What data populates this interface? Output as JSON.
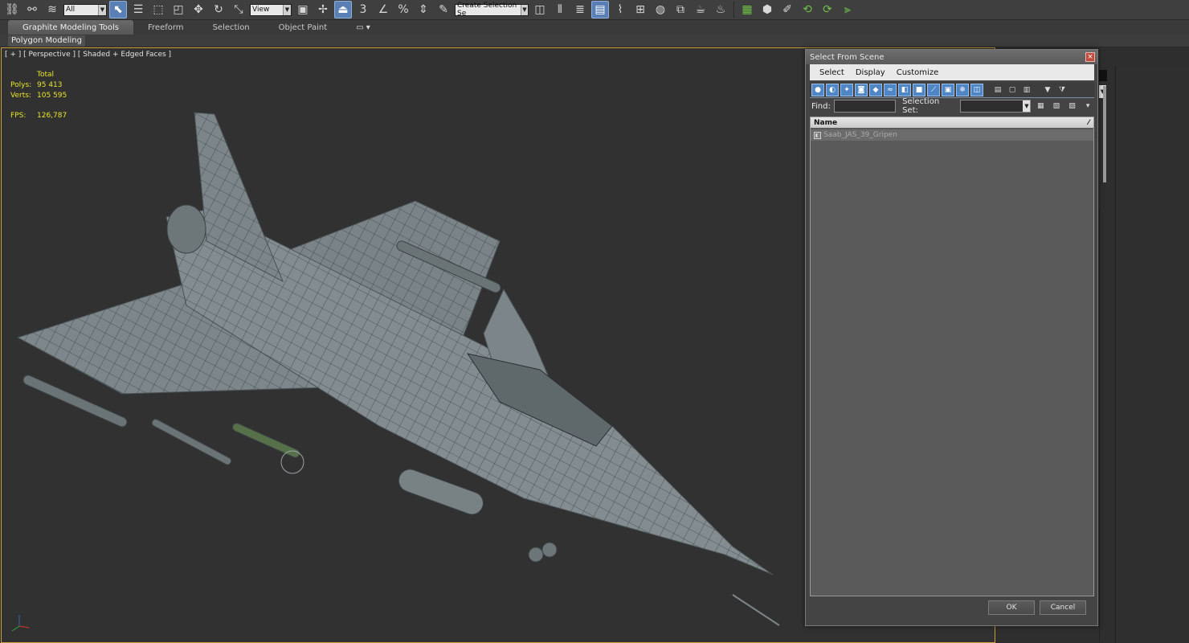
{
  "toolbar": {
    "filter_value": "All",
    "view_value": "View",
    "selection_set_placeholder": "Create Selection Se",
    "snap_label": "3",
    "percent_label": "%",
    "icons_left": [
      "link-icon",
      "unlink-icon",
      "bind-spacewarp-icon"
    ],
    "icons_select": [
      "select-object-icon",
      "select-by-name-icon",
      "rect-region-icon",
      "window-crossing-icon"
    ],
    "icons_transform": [
      "move-icon",
      "rotate-icon",
      "scale-icon"
    ]
  },
  "ribbon": {
    "tabs": [
      "Graphite Modeling Tools",
      "Freeform",
      "Selection",
      "Object Paint"
    ],
    "panel": "Polygon Modeling"
  },
  "viewport": {
    "label": "[ + ] [ Perspective ] [ Shaded + Edged Faces ]",
    "stats_header": "Total",
    "polys_label": "Polys:",
    "polys_value": "95 413",
    "verts_label": "Verts:",
    "verts_value": "105 595",
    "fps_label": "FPS:",
    "fps_value": "126,787"
  },
  "dialog": {
    "title": "Select From Scene",
    "close_icon": "×",
    "menu": [
      "Select",
      "Display",
      "Customize"
    ],
    "find_label": "Find:",
    "selection_set_label": "Selection Set:",
    "column_name": "Name",
    "rows": [
      "Saab_JAS_39_Gripen"
    ],
    "ok_label": "OK",
    "cancel_label": "Cancel"
  },
  "colors": {
    "viewport_border": "#c9a03a",
    "stats_text": "#e8e42a",
    "active_blue": "#4f86c6"
  }
}
